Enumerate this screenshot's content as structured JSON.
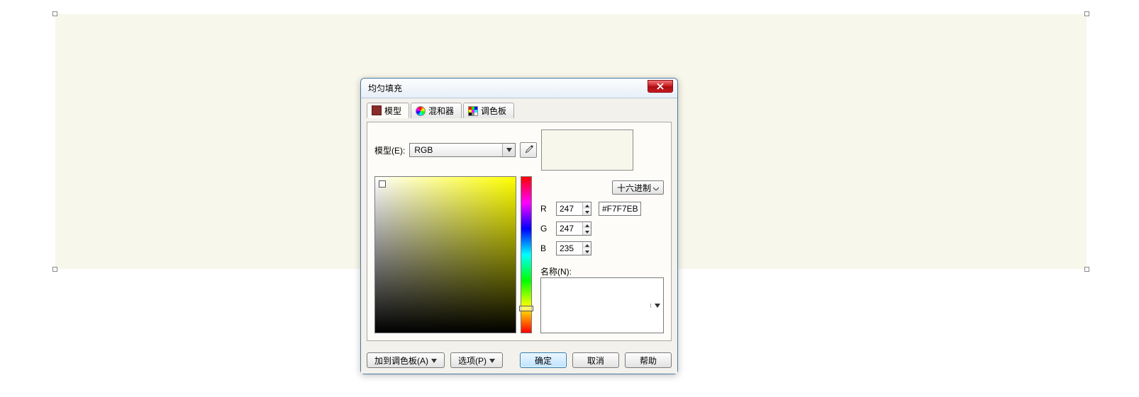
{
  "canvas": {
    "fill": "#F7F7EB"
  },
  "dialog": {
    "title": "均匀填充",
    "tabs": {
      "model": "模型",
      "mixer": "混和器",
      "palette": "调色板"
    },
    "model_label": "模型(E):",
    "model_value": "RGB",
    "hex_button": "十六进制",
    "channels": {
      "r_label": "R",
      "g_label": "G",
      "b_label": "B",
      "r": "247",
      "g": "247",
      "b": "235"
    },
    "hex_value": "#F7F7EB",
    "name_label": "名称(N):",
    "name_value": "",
    "preview_color": "#F7F7EB"
  },
  "footer": {
    "add_to_palette": "加到调色板(A)",
    "options": "选项(P)",
    "ok": "确定",
    "cancel": "取消",
    "help": "帮助"
  }
}
